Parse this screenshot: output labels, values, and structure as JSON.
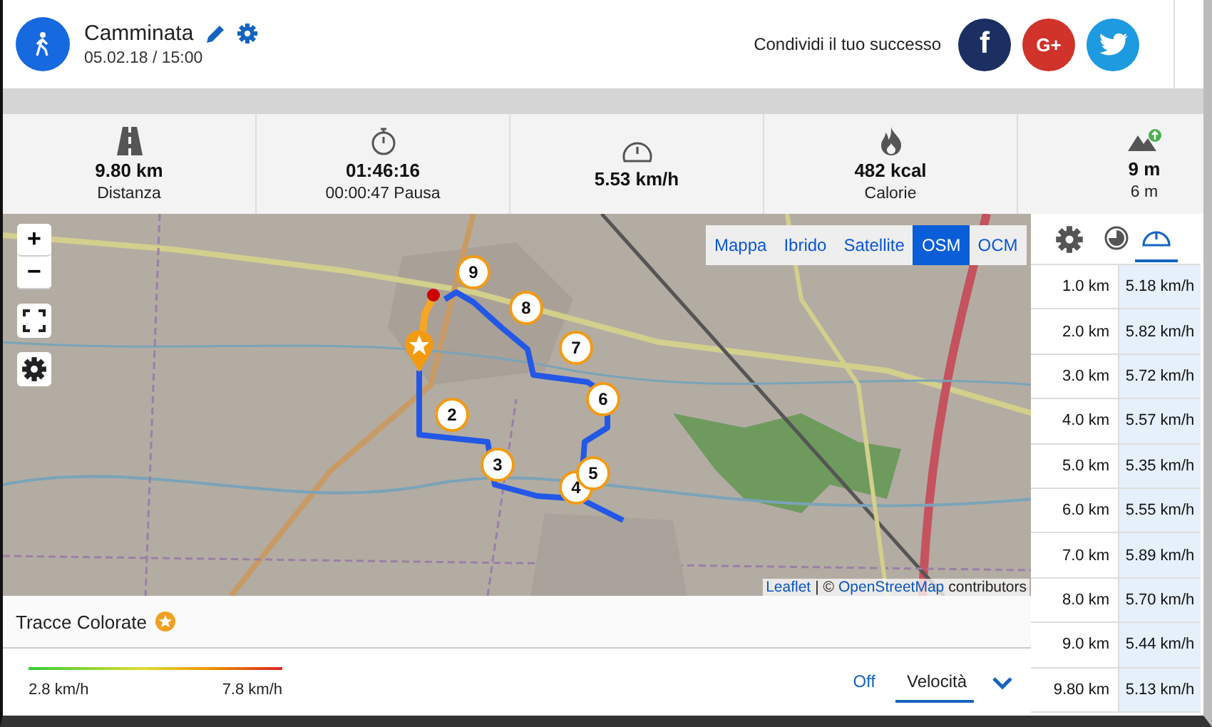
{
  "activity": {
    "title": "Camminata",
    "date": "05.02.18 / 15:00"
  },
  "share": {
    "label": "Condividi il tuo successo",
    "buttons": [
      {
        "kind": "facebook",
        "label": "f"
      },
      {
        "kind": "google",
        "label": "G+"
      },
      {
        "kind": "twitter"
      }
    ]
  },
  "stats": [
    {
      "kind": "distance",
      "value": "9.80 km",
      "label": "Distanza"
    },
    {
      "kind": "duration",
      "value": "01:46:16",
      "label": "00:00:47 Pausa"
    },
    {
      "kind": "speed",
      "value": "5.53 km/h"
    },
    {
      "kind": "calories",
      "value": "482 kcal",
      "label": "Calorie"
    },
    {
      "kind": "elevation",
      "value": "9 m",
      "label": "6 m"
    }
  ],
  "map": {
    "zoom_buttons": [
      "+",
      "−"
    ],
    "layers": [
      {
        "label": "Mappa",
        "selected": false
      },
      {
        "label": "Ibrido",
        "selected": false
      },
      {
        "label": "Satellite",
        "selected": false
      },
      {
        "label": "OSM",
        "selected": true
      },
      {
        "label": "OCM",
        "selected": false
      }
    ],
    "markers": [
      "2",
      "3",
      "4",
      "5",
      "6",
      "7",
      "8",
      "9"
    ],
    "attribution": {
      "link1": "Leaflet",
      "separator": "| ©",
      "link2": "OpenStreetMap",
      "suffix": "contributors"
    }
  },
  "splits": {
    "tabs": [
      {
        "kind": "pace",
        "selected": false
      },
      {
        "kind": "speed",
        "selected": true
      }
    ],
    "rows": [
      {
        "distance": "1.0 km",
        "speed": "5.18 km/h"
      },
      {
        "distance": "2.0 km",
        "speed": "5.82 km/h"
      },
      {
        "distance": "3.0 km",
        "speed": "5.72 km/h"
      },
      {
        "distance": "4.0 km",
        "speed": "5.57 km/h"
      },
      {
        "distance": "5.0 km",
        "speed": "5.35 km/h"
      },
      {
        "distance": "6.0 km",
        "speed": "5.55 km/h"
      },
      {
        "distance": "7.0 km",
        "speed": "5.89 km/h"
      },
      {
        "distance": "8.0 km",
        "speed": "5.70 km/h"
      },
      {
        "distance": "9.0 km",
        "speed": "5.44 km/h"
      },
      {
        "distance": "9.80 km",
        "speed": "5.13 km/h"
      }
    ]
  },
  "colored_tracks": {
    "title": "Tracce Colorate",
    "min": "2.8 km/h",
    "max": "7.8 km/h",
    "options": [
      {
        "label": "Off",
        "selected": false
      },
      {
        "label": "Velocità",
        "selected": true
      }
    ]
  }
}
